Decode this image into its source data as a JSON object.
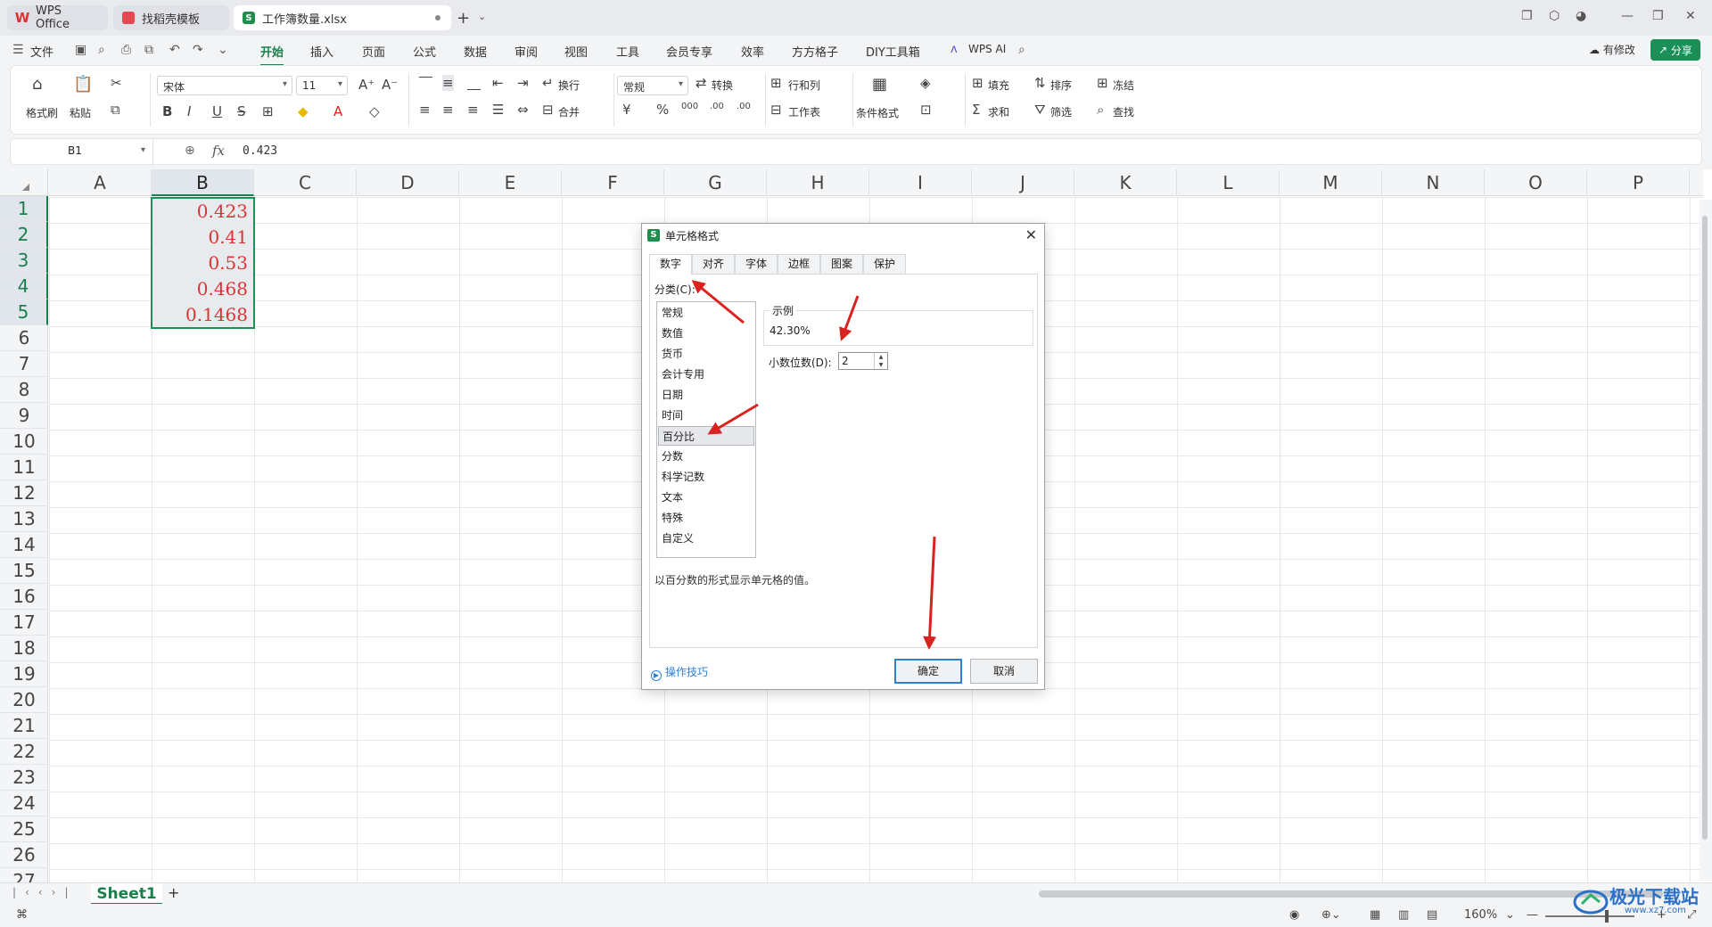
{
  "tabs": {
    "wps_label": "WPS Office",
    "templates_label": "找稻壳模板",
    "file_label": "工作簿数量.xlsx",
    "wps_logo_char": "W",
    "file_logo_char": "S"
  },
  "menu": {
    "file_label": "文件",
    "items": [
      "开始",
      "插入",
      "页面",
      "公式",
      "数据",
      "审阅",
      "视图",
      "工具",
      "会员专享",
      "效率",
      "方方格子",
      "DIY工具箱"
    ],
    "active_index": 0,
    "wps_ai_label": "WPS AI",
    "modify_label": "有修改",
    "share_label": "分享"
  },
  "ribbon": {
    "format_painter": "格式刷",
    "paste": "粘贴",
    "font_name": "宋体",
    "font_size": "11",
    "wrap": "换行",
    "merge": "合并",
    "number_format": "常规",
    "convert": "转换",
    "rows_cols": "行和列",
    "worksheet": "工作表",
    "conditional_format": "条件格式",
    "fill": "填充",
    "sort": "排序",
    "freeze": "冻结",
    "sum": "求和",
    "filter": "筛选",
    "find": "查找",
    "bold": "B",
    "italic": "I",
    "underline": "U",
    "strike": "S",
    "currency": "¥",
    "percent": "%",
    "thousands": "000",
    "dec_inc": ".00",
    "dec_dec": ".00"
  },
  "formula_bar": {
    "name_box": "B1",
    "fx": "fx",
    "value": "0.423"
  },
  "grid": {
    "columns": [
      "A",
      "B",
      "C",
      "D",
      "E",
      "F",
      "G",
      "H",
      "I",
      "J",
      "K",
      "L",
      "M",
      "N",
      "O",
      "P"
    ],
    "rows": [
      "1",
      "2",
      "3",
      "4",
      "5",
      "6",
      "7",
      "8",
      "9",
      "10",
      "11",
      "12",
      "13",
      "14",
      "15",
      "16",
      "17",
      "18",
      "19",
      "20",
      "21",
      "22",
      "23",
      "24",
      "25",
      "26",
      "27"
    ],
    "selected_column": "B",
    "b_values": [
      "0.423",
      "0.41",
      "0.53",
      "0.468",
      "0.1468"
    ]
  },
  "sheet_tabs": {
    "sheet1": "Sheet1",
    "add": "+"
  },
  "status_bar": {
    "zoom": "160%"
  },
  "dialog": {
    "title": "单元格格式",
    "tabs": [
      "数字",
      "对齐",
      "字体",
      "边框",
      "图案",
      "保护"
    ],
    "active_tab": 0,
    "category_label": "分类(C):",
    "categories": [
      "常规",
      "数值",
      "货币",
      "会计专用",
      "日期",
      "时间",
      "百分比",
      "分数",
      "科学记数",
      "文本",
      "特殊",
      "自定义"
    ],
    "selected_category": 6,
    "sample_label": "示例",
    "sample_value": "42.30%",
    "decimal_label": "小数位数(D):",
    "decimal_value": "2",
    "description": "以百分数的形式显示单元格的值。",
    "tips_label": "操作技巧",
    "ok_label": "确定",
    "cancel_label": "取消"
  },
  "watermark": {
    "name": "极光下载站",
    "url": "www.xz7.com"
  },
  "colors": {
    "accent_green": "#1a7f4b",
    "cell_text_red": "#d33333",
    "arrow_red": "#d9231f",
    "link_blue": "#2f7fd0"
  }
}
